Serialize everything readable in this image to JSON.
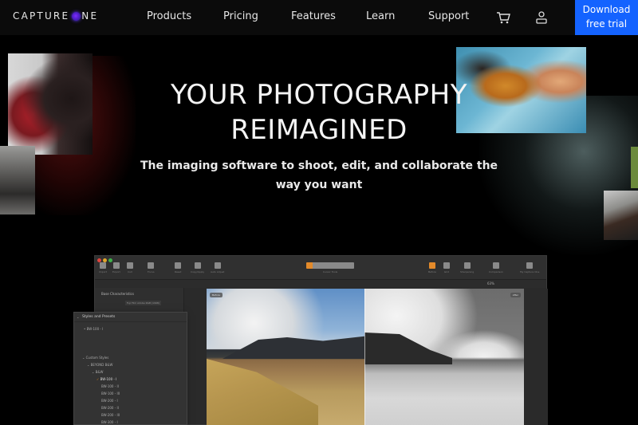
{
  "nav": {
    "logo_text_1": "CAPTURE ",
    "logo_text_2": "NE",
    "links": [
      "Products",
      "Pricing",
      "Features",
      "Learn",
      "Support"
    ],
    "icons": [
      "cart-icon",
      "user-icon"
    ],
    "cta_line1": "Download",
    "cta_line2": "free trial",
    "cta_color": "#1463ff"
  },
  "hero": {
    "title_line1": "YOUR PHOTOGRAPHY",
    "title_line2": "REIMAGINED",
    "subtitle": "The imaging software to shoot, edit, and collaborate the way you want"
  },
  "app": {
    "toolbar_items": [
      "Import",
      "Export",
      "Cull",
      "Focus",
      "Reset",
      "Copy/Apply",
      "Auto Adjust",
      "Cursor Tools",
      "Before",
      "Grid",
      "Sharpening",
      "Comparison",
      "My Capture One"
    ],
    "zoom_level": "63%",
    "viewer_tags": [
      "Before",
      "After"
    ],
    "styles_panel": {
      "title": "Styles and Presets",
      "applied": "BW-100 - I",
      "tree": [
        {
          "label": "Custom Styles",
          "level": 0
        },
        {
          "label": "BEYOND B&W",
          "level": 1
        },
        {
          "label": "B&W",
          "level": 2
        },
        {
          "label": "BW-100 - I",
          "level": 3,
          "checked": true
        },
        {
          "label": "BW-100 - II",
          "level": 3
        },
        {
          "label": "BW-100 - III",
          "level": 3
        },
        {
          "label": "BW-200 - I",
          "level": 3
        },
        {
          "label": "BW-200 - II",
          "level": 3
        },
        {
          "label": "BW-200 - III",
          "level": 3
        },
        {
          "label": "BW-300 - I",
          "level": 3
        }
      ]
    },
    "base_panel_title": "Base Characteristics",
    "base_profile": "Fuji Film Adobe RGB (1998)"
  }
}
